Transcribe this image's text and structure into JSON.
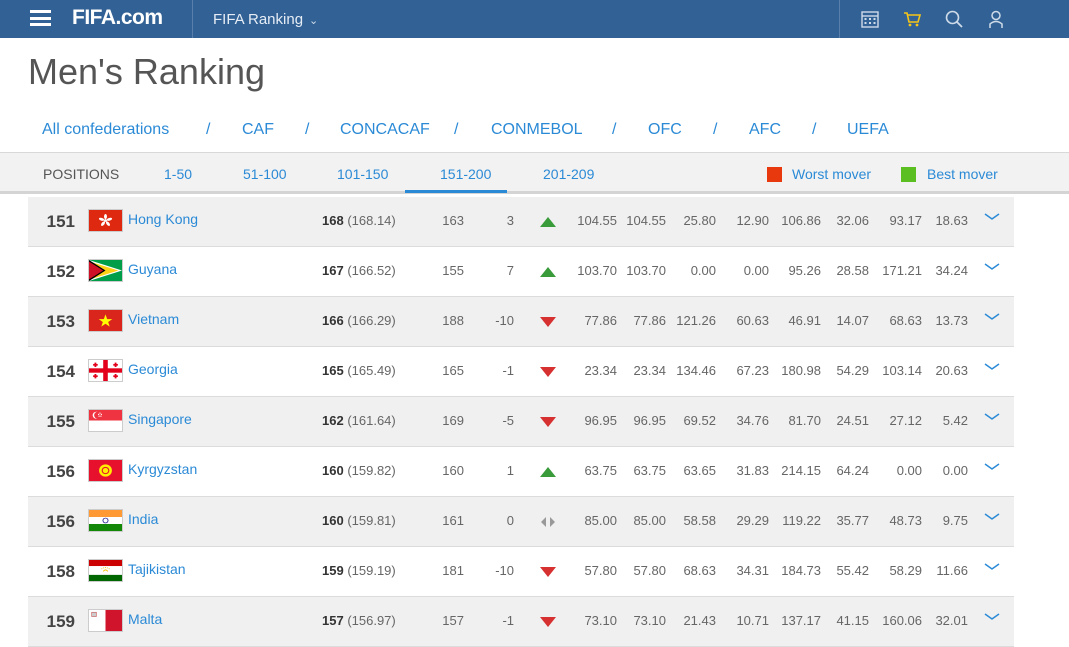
{
  "header": {
    "logo_main": "FIFA",
    "logo_suffix": ".com",
    "section_label": "FIFA Ranking",
    "icons": [
      "menu-icon",
      "calendar-icon",
      "cart-icon",
      "search-icon",
      "user-icon"
    ]
  },
  "page": {
    "title": "Men's Ranking"
  },
  "confederations": [
    "All confederations",
    "CAF",
    "CONCACAF",
    "CONMEBOL",
    "OFC",
    "AFC",
    "UEFA"
  ],
  "positions": {
    "label": "POSITIONS",
    "tabs": [
      "1-50",
      "51-100",
      "101-150",
      "151-200",
      "201-209"
    ],
    "active": "151-200",
    "worst_mover": "Worst mover",
    "best_mover": "Best mover",
    "worst_color": "#e8380d",
    "best_color": "#5bbf21"
  },
  "rows": [
    {
      "rank": "151",
      "country": "Hong Kong",
      "flag": "hong-kong-flag",
      "points": "168",
      "points_exact": "(168.14)",
      "prev_points": "163",
      "change": "3",
      "trend": "up",
      "c1": "104.55",
      "c2": "104.55",
      "c3": "25.80",
      "c4": "12.90",
      "c5": "106.86",
      "c6": "32.06",
      "c7": "93.17",
      "c8": "18.63"
    },
    {
      "rank": "152",
      "country": "Guyana",
      "flag": "guyana-flag",
      "points": "167",
      "points_exact": "(166.52)",
      "prev_points": "155",
      "change": "7",
      "trend": "up",
      "c1": "103.70",
      "c2": "103.70",
      "c3": "0.00",
      "c4": "0.00",
      "c5": "95.26",
      "c6": "28.58",
      "c7": "171.21",
      "c8": "34.24"
    },
    {
      "rank": "153",
      "country": "Vietnam",
      "flag": "vietnam-flag",
      "points": "166",
      "points_exact": "(166.29)",
      "prev_points": "188",
      "change": "-10",
      "trend": "down",
      "c1": "77.86",
      "c2": "77.86",
      "c3": "121.26",
      "c4": "60.63",
      "c5": "46.91",
      "c6": "14.07",
      "c7": "68.63",
      "c8": "13.73"
    },
    {
      "rank": "154",
      "country": "Georgia",
      "flag": "georgia-flag",
      "points": "165",
      "points_exact": "(165.49)",
      "prev_points": "165",
      "change": "-1",
      "trend": "down",
      "c1": "23.34",
      "c2": "23.34",
      "c3": "134.46",
      "c4": "67.23",
      "c5": "180.98",
      "c6": "54.29",
      "c7": "103.14",
      "c8": "20.63"
    },
    {
      "rank": "155",
      "country": "Singapore",
      "flag": "singapore-flag",
      "points": "162",
      "points_exact": "(161.64)",
      "prev_points": "169",
      "change": "-5",
      "trend": "down",
      "c1": "96.95",
      "c2": "96.95",
      "c3": "69.52",
      "c4": "34.76",
      "c5": "81.70",
      "c6": "24.51",
      "c7": "27.12",
      "c8": "5.42"
    },
    {
      "rank": "156",
      "country": "Kyrgyzstan",
      "flag": "kyrgyzstan-flag",
      "points": "160",
      "points_exact": "(159.82)",
      "prev_points": "160",
      "change": "1",
      "trend": "up",
      "c1": "63.75",
      "c2": "63.75",
      "c3": "63.65",
      "c4": "31.83",
      "c5": "214.15",
      "c6": "64.24",
      "c7": "0.00",
      "c8": "0.00"
    },
    {
      "rank": "156",
      "country": "India",
      "flag": "india-flag",
      "points": "160",
      "points_exact": "(159.81)",
      "prev_points": "161",
      "change": "0",
      "trend": "same",
      "c1": "85.00",
      "c2": "85.00",
      "c3": "58.58",
      "c4": "29.29",
      "c5": "119.22",
      "c6": "35.77",
      "c7": "48.73",
      "c8": "9.75"
    },
    {
      "rank": "158",
      "country": "Tajikistan",
      "flag": "tajikistan-flag",
      "points": "159",
      "points_exact": "(159.19)",
      "prev_points": "181",
      "change": "-10",
      "trend": "down",
      "c1": "57.80",
      "c2": "57.80",
      "c3": "68.63",
      "c4": "34.31",
      "c5": "184.73",
      "c6": "55.42",
      "c7": "58.29",
      "c8": "11.66"
    },
    {
      "rank": "159",
      "country": "Malta",
      "flag": "malta-flag",
      "points": "157",
      "points_exact": "(156.97)",
      "prev_points": "157",
      "change": "-1",
      "trend": "down",
      "c1": "73.10",
      "c2": "73.10",
      "c3": "21.43",
      "c4": "10.71",
      "c5": "137.17",
      "c6": "41.15",
      "c7": "160.06",
      "c8": "32.01"
    }
  ]
}
